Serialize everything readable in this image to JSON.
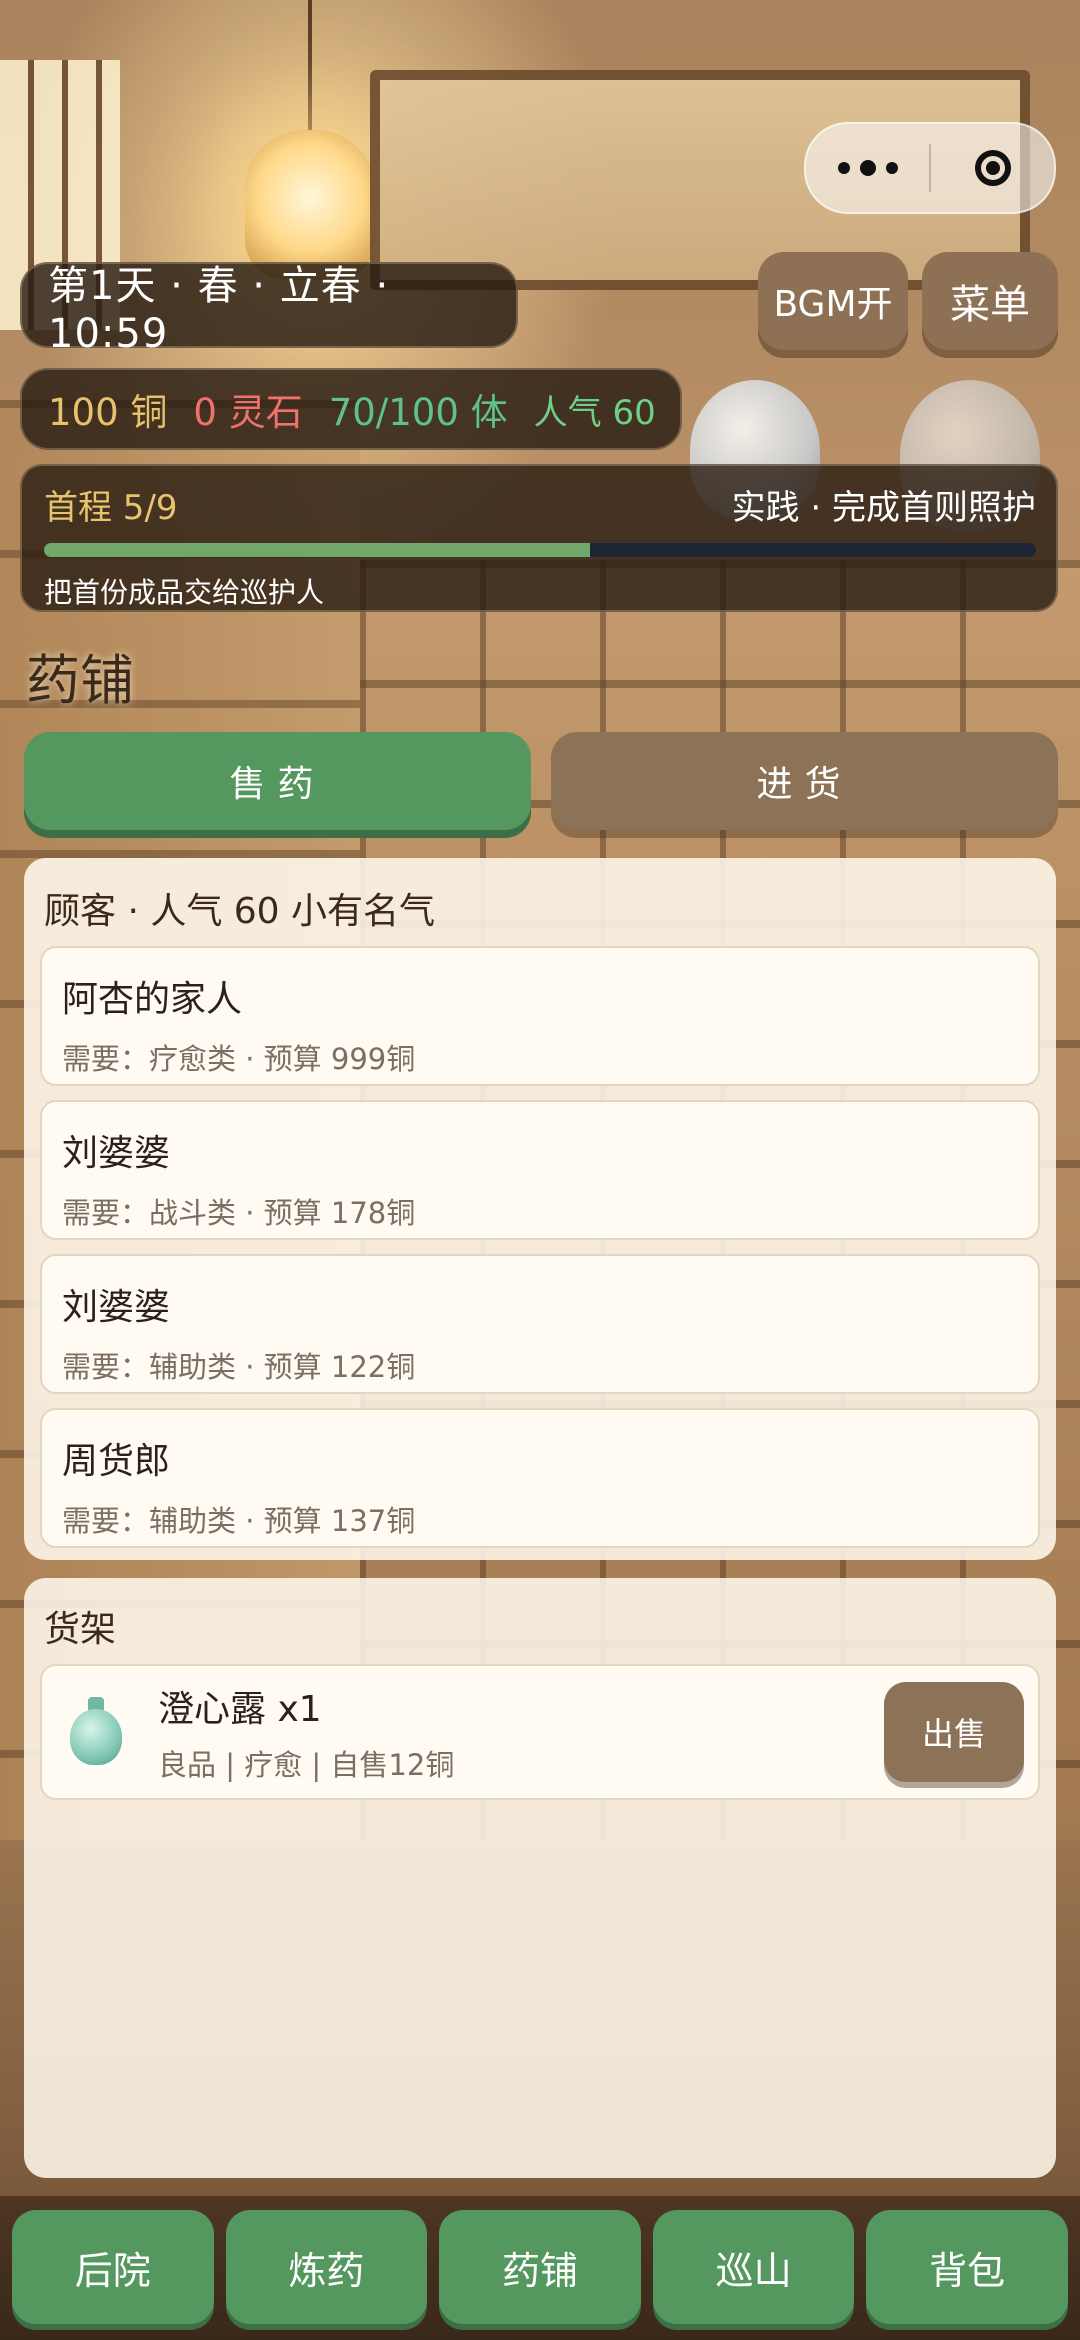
{
  "capsule": {
    "more_icon": "more-dots-icon",
    "close_icon": "target-circle-icon"
  },
  "status": {
    "day_time": "第1天 · 春 · 立春 · 10:59",
    "copper": "100 铜",
    "spirit_stone": "0 灵石",
    "stamina": "70/100 体",
    "popularity": "人气 60"
  },
  "buttons": {
    "bgm": "BGM开",
    "menu": "菜单"
  },
  "quest": {
    "progress_label": "首程 5/9",
    "title": "实践 · 完成首则照护",
    "description": "把首份成品交给巡护人",
    "progress_fraction": 0.55
  },
  "page_title": "药铺",
  "tabs": [
    {
      "label": "售药",
      "active": true
    },
    {
      "label": "进货",
      "active": false
    }
  ],
  "customers": {
    "header": "顾客 · 人气 60 小有名气",
    "items": [
      {
        "name": "阿杏的家人",
        "need": "需要：疗愈类 · 预算 999铜"
      },
      {
        "name": "刘婆婆",
        "need": "需要：战斗类 · 预算 178铜"
      },
      {
        "name": "刘婆婆",
        "need": "需要：辅助类 · 预算 122铜"
      },
      {
        "name": "周货郎",
        "need": "需要：辅助类 · 预算 137铜"
      }
    ]
  },
  "shelf": {
    "header": "货架",
    "items": [
      {
        "icon": "potion-bottle-icon",
        "name": "澄心露 x1",
        "meta": "良品 | 疗愈 | 自售12铜",
        "action": "出售"
      }
    ]
  },
  "nav": [
    "后院",
    "炼药",
    "药铺",
    "巡山",
    "背包"
  ],
  "colors": {
    "green": "#55985f",
    "brown": "#8c7256",
    "copper": "#e6c26a",
    "stone": "#f0726a",
    "stamina": "#5fc28a"
  }
}
